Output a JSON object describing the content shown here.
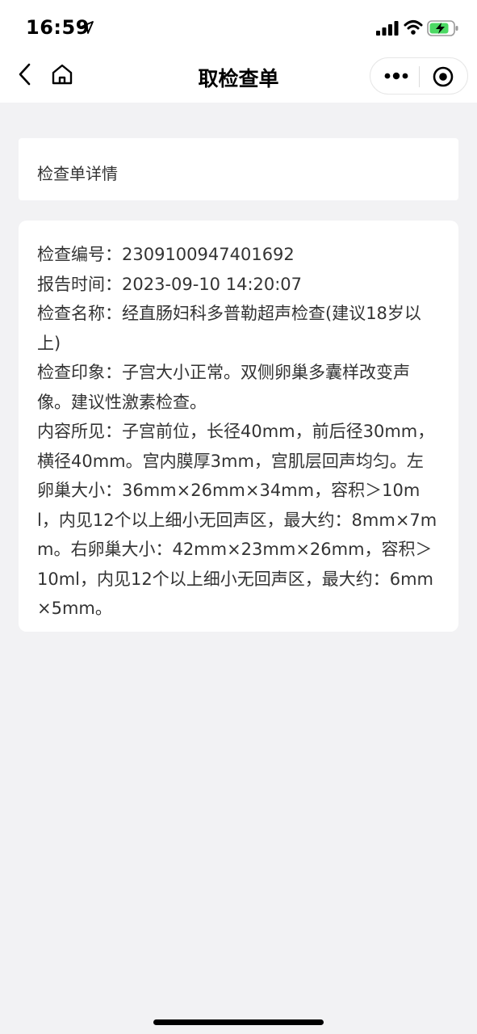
{
  "status_bar": {
    "time": "16:59",
    "icons": [
      "location-arrow-icon",
      "cellular-signal-icon",
      "wifi-icon",
      "battery-charging-icon"
    ]
  },
  "nav": {
    "title": "取检查单",
    "icons": [
      "back-icon",
      "home-icon",
      "more-icon",
      "close-miniprogram-icon"
    ]
  },
  "detail_header": {
    "label": "检查单详情"
  },
  "report": {
    "exam_number": "检查编号：2309100947401692",
    "report_time": "报告时间：2023-09-10 14:20:07",
    "exam_name": "检查名称：经直肠妇科多普勒超声检查(建议18岁以上)",
    "impression": "检查印象：子宫大小正常。双侧卵巢多囊样改变声像。建议性激素检查。",
    "findings": "内容所见：子宫前位，长径40mm，前后径30mm，横径40mm。宫内膜厚3mm，宫肌层回声均匀。左卵巢大小：36mm×26mm×34mm，容积＞10ml，内见12个以上细小无回声区，最大约：8mm×7mm。右卵巢大小：42mm×23mm×26mm，容积＞10ml，内见12个以上细小无回声区，最大约：6mm×5mm。"
  },
  "colors": {
    "background": "#f2f2f4",
    "card": "#ffffff",
    "text": "#333333",
    "battery_green": "#4cd964"
  }
}
